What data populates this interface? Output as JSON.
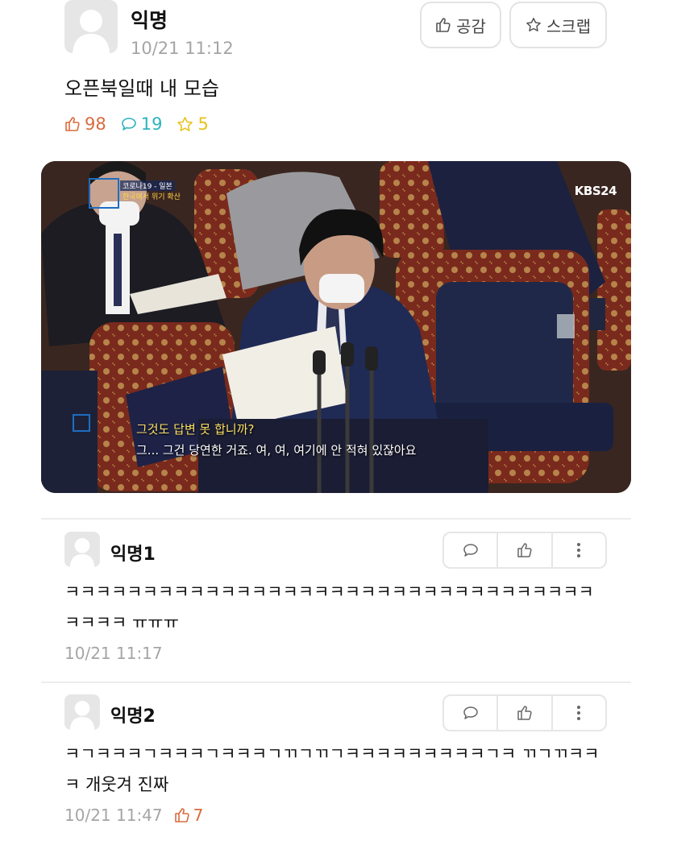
{
  "post": {
    "author": "익명",
    "time": "10/21 11:12",
    "like_button": "공감",
    "scrap_button": "스크랩",
    "text": "오픈북일때 내 모습",
    "stats": {
      "likes": "98",
      "comments": "19",
      "scraps": "5"
    }
  },
  "video": {
    "channel_logo": "KBS24",
    "caption_top": "코로나19 - 일본",
    "caption_bottom": "한국에서 위기 확산",
    "subtitle_line1": "그것도 답변 못 합니까?",
    "subtitle_line2": "그... 그건 당연한 거죠. 여, 여, 여기에 안 적혀 있잖아요"
  },
  "comments": [
    {
      "author": "익명1",
      "text": "ㅋㅋㅋㅋㅋㅋㅋㅋㅋㅋㅋㅋㅋㅋㅋㅋㅋㅋㅋㅋㅋㅋㅋㅋㅋㅋㅋㅋㅋㅋㅋㅋㅋㅋ ㅋㅋㅋㅋ ㅠㅠㅠ",
      "time": "10/21 11:17",
      "likes": ""
    },
    {
      "author": "익명2",
      "text": "ㅋㄱㅋㅋㅋㄱㅋㅋㅋㄱㅋㅋㅋㄱㄲㄱㄲㄱㅋㅋㅋㅋㅋㅋㅋㅋㅋㄱㅋ ㄲㄱㄲㅋㅋㅋ 개웃겨 진짜",
      "time": "10/21 11:47",
      "likes": "7"
    }
  ],
  "colors": {
    "like": "#d96b3e",
    "comment": "#2bb3c0",
    "scrap": "#e8c21c",
    "muted": "#a5a5a5"
  },
  "icons": {
    "thumbs_up": "thumbs-up-icon",
    "comment": "comment-bubble-icon",
    "star": "star-icon",
    "more": "more-vertical-icon",
    "avatar": "anonymous-avatar-icon"
  }
}
